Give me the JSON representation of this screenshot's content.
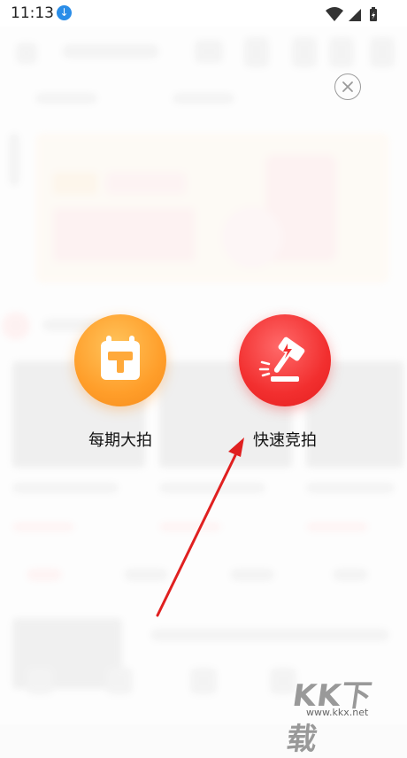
{
  "status_bar": {
    "time": "11:13",
    "download_icon": "download-icon",
    "wifi_icon": "wifi-icon",
    "signal_icon": "signal-icon",
    "battery_icon": "battery-icon"
  },
  "overlay": {
    "close_icon": "close-icon",
    "actions": [
      {
        "label": "每期大拍",
        "icon": "calendar-gavel-icon",
        "color": "#ff9e2a"
      },
      {
        "label": "快速竞拍",
        "icon": "flash-gavel-icon",
        "color": "#f22f2f"
      }
    ],
    "arrow_color": "#e02020"
  },
  "watermark": {
    "text": "KK下载",
    "url": "www.kkx.net"
  },
  "colors": {
    "accent_red": "#f22f2f",
    "accent_orange": "#ff9e2a"
  }
}
